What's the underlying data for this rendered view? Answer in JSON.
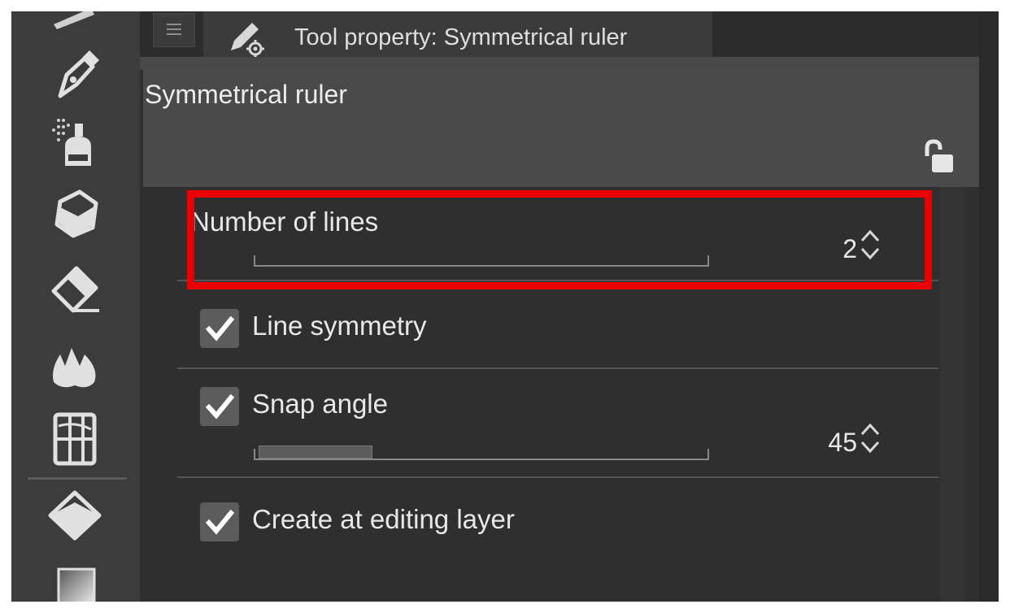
{
  "panel": {
    "tab_title": "Tool property: Symmetrical ruler",
    "header_title": "Symmetrical ruler"
  },
  "toolbar": {
    "tools": [
      "pen-tool-icon",
      "airbrush-tool-icon",
      "decoration-tool-icon",
      "eraser-tool-icon",
      "blend-tool-icon",
      "figure-tool-icon",
      "fill-tool-icon",
      "gradient-tool-icon"
    ]
  },
  "properties": {
    "number_of_lines": {
      "label": "Number of lines",
      "value": "2",
      "slider_fraction": 0.0
    },
    "line_symmetry": {
      "label": "Line symmetry",
      "checked": true
    },
    "snap_angle": {
      "label": "Snap angle",
      "value": "45",
      "checked": true,
      "slider_fraction": 0.25
    },
    "create_at_editing_layer": {
      "label": "Create at editing layer",
      "checked": true
    }
  },
  "colors": {
    "highlight": "#ea0000",
    "panel_bg": "#2f2f2f",
    "header_bg": "#4a4a4a"
  }
}
